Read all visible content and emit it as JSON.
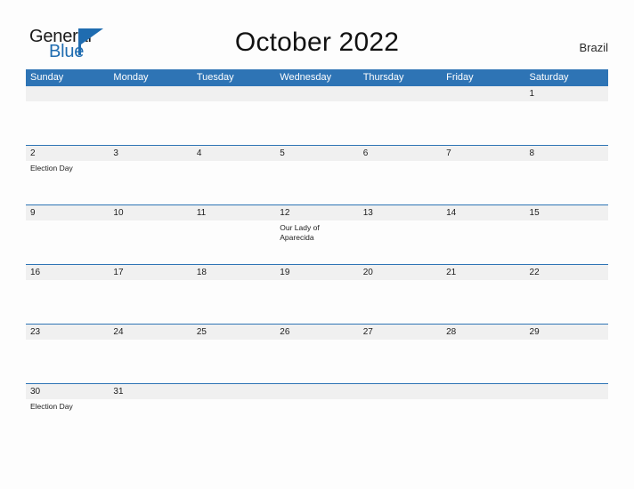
{
  "header": {
    "logo": {
      "word_one": "General",
      "word_two": "Blue",
      "mark": "blue-pennant-icon",
      "accent_color": "#1f6cb0"
    },
    "title": "October 2022",
    "country": "Brazil"
  },
  "colors": {
    "header_bar": "#2e74b5",
    "number_band": "#f0f0f0",
    "row_divider": "#2e74b5",
    "page_background": "#fdfdfd",
    "text": "#1d1d1d"
  },
  "calendar": {
    "month": "October",
    "year": "2022",
    "weekdays": [
      "Sunday",
      "Monday",
      "Tuesday",
      "Wednesday",
      "Thursday",
      "Friday",
      "Saturday"
    ],
    "weeks": [
      [
        {
          "day": "",
          "event": ""
        },
        {
          "day": "",
          "event": ""
        },
        {
          "day": "",
          "event": ""
        },
        {
          "day": "",
          "event": ""
        },
        {
          "day": "",
          "event": ""
        },
        {
          "day": "",
          "event": ""
        },
        {
          "day": "1",
          "event": ""
        }
      ],
      [
        {
          "day": "2",
          "event": "Election Day"
        },
        {
          "day": "3",
          "event": ""
        },
        {
          "day": "4",
          "event": ""
        },
        {
          "day": "5",
          "event": ""
        },
        {
          "day": "6",
          "event": ""
        },
        {
          "day": "7",
          "event": ""
        },
        {
          "day": "8",
          "event": ""
        }
      ],
      [
        {
          "day": "9",
          "event": ""
        },
        {
          "day": "10",
          "event": ""
        },
        {
          "day": "11",
          "event": ""
        },
        {
          "day": "12",
          "event": "Our Lady of Aparecida"
        },
        {
          "day": "13",
          "event": ""
        },
        {
          "day": "14",
          "event": ""
        },
        {
          "day": "15",
          "event": ""
        }
      ],
      [
        {
          "day": "16",
          "event": ""
        },
        {
          "day": "17",
          "event": ""
        },
        {
          "day": "18",
          "event": ""
        },
        {
          "day": "19",
          "event": ""
        },
        {
          "day": "20",
          "event": ""
        },
        {
          "day": "21",
          "event": ""
        },
        {
          "day": "22",
          "event": ""
        }
      ],
      [
        {
          "day": "23",
          "event": ""
        },
        {
          "day": "24",
          "event": ""
        },
        {
          "day": "25",
          "event": ""
        },
        {
          "day": "26",
          "event": ""
        },
        {
          "day": "27",
          "event": ""
        },
        {
          "day": "28",
          "event": ""
        },
        {
          "day": "29",
          "event": ""
        }
      ],
      [
        {
          "day": "30",
          "event": "Election Day"
        },
        {
          "day": "31",
          "event": ""
        },
        {
          "day": "",
          "event": ""
        },
        {
          "day": "",
          "event": ""
        },
        {
          "day": "",
          "event": ""
        },
        {
          "day": "",
          "event": ""
        },
        {
          "day": "",
          "event": ""
        }
      ]
    ]
  }
}
